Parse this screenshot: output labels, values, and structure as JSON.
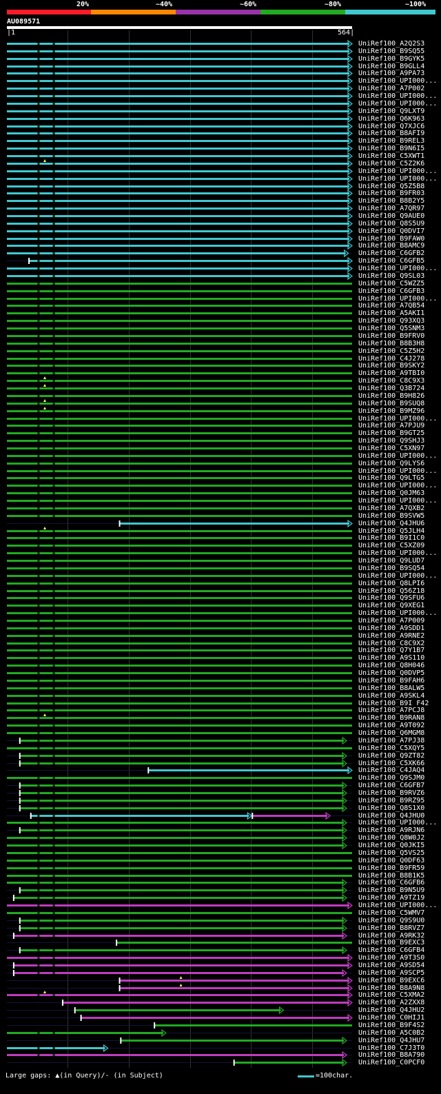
{
  "colors": {
    "cyan": "#40c8d0",
    "green": "#22aa22",
    "magenta": "#c03cc0",
    "red": "#ff1a2a",
    "orange": "#ff8800",
    "purple": "#9933aa",
    "gap_marker": "#ffff66"
  },
  "legend": {
    "labels": [
      "20%",
      "~40%",
      "~60%",
      "~80%",
      "~100%"
    ],
    "colors": [
      "#ff1a2a",
      "#ff8800",
      "#9933aa",
      "#22aa22",
      "#40c8d0"
    ]
  },
  "query": {
    "name": "AU089571",
    "start": "1",
    "end": "564"
  },
  "hits": [
    {
      "name": "UniRef100_A2Q2S3",
      "color": "cyan",
      "start": 0,
      "end": 564,
      "arrow": true
    },
    {
      "name": "UniRef100_B9SQ55",
      "color": "cyan",
      "start": 0,
      "end": 564,
      "arrow": true
    },
    {
      "name": "UniRef100_B9GYK5",
      "color": "cyan",
      "start": 0,
      "end": 564,
      "arrow": true
    },
    {
      "name": "UniRef100_B9GLL4",
      "color": "cyan",
      "start": 0,
      "end": 564,
      "arrow": true
    },
    {
      "name": "UniRef100_A9PA73",
      "color": "cyan",
      "start": 0,
      "end": 564,
      "arrow": true
    },
    {
      "name": "UniRef100_UPI000...",
      "color": "cyan",
      "start": 0,
      "end": 564,
      "arrow": true
    },
    {
      "name": "UniRef100_A7P002",
      "color": "cyan",
      "start": 0,
      "end": 564,
      "arrow": true
    },
    {
      "name": "UniRef100_UPI000...",
      "color": "cyan",
      "start": 0,
      "end": 564,
      "arrow": true
    },
    {
      "name": "UniRef100_UPI000...",
      "color": "cyan",
      "start": 0,
      "end": 564,
      "arrow": true
    },
    {
      "name": "UniRef100_Q9LXT9",
      "color": "cyan",
      "start": 0,
      "end": 564,
      "arrow": true
    },
    {
      "name": "UniRef100_Q6K963",
      "color": "cyan",
      "start": 0,
      "end": 564,
      "arrow": true
    },
    {
      "name": "UniRef100_Q7XJC6",
      "color": "cyan",
      "start": 0,
      "end": 564,
      "arrow": true
    },
    {
      "name": "UniRef100_B8AFI9",
      "color": "cyan",
      "start": 0,
      "end": 564,
      "arrow": true
    },
    {
      "name": "UniRef100_B9REL3",
      "color": "cyan",
      "start": 0,
      "end": 564,
      "arrow": true
    },
    {
      "name": "UniRef100_B9N6I5",
      "color": "cyan",
      "start": 0,
      "end": 564,
      "arrow": true
    },
    {
      "name": "UniRef100_C5XWT1",
      "color": "cyan",
      "start": 0,
      "end": 564,
      "arrow": true
    },
    {
      "name": "UniRef100_C5Z2K6",
      "color": "cyan",
      "start": 0,
      "end": 564,
      "arrow": true,
      "gap": true
    },
    {
      "name": "UniRef100_UPI000...",
      "color": "cyan",
      "start": 0,
      "end": 564,
      "arrow": true
    },
    {
      "name": "UniRef100_UPI000...",
      "color": "cyan",
      "start": 0,
      "end": 564,
      "arrow": true
    },
    {
      "name": "UniRef100_Q5Z5B8",
      "color": "cyan",
      "start": 0,
      "end": 564,
      "arrow": true
    },
    {
      "name": "UniRef100_B9FR03",
      "color": "cyan",
      "start": 0,
      "end": 564,
      "arrow": true
    },
    {
      "name": "UniRef100_B8B2Y5",
      "color": "cyan",
      "start": 0,
      "end": 564,
      "arrow": true
    },
    {
      "name": "UniRef100_A7QR97",
      "color": "cyan",
      "start": 0,
      "end": 564,
      "arrow": true
    },
    {
      "name": "UniRef100_Q9AUE0",
      "color": "cyan",
      "start": 0,
      "end": 564,
      "arrow": true
    },
    {
      "name": "UniRef100_Q8S5U9",
      "color": "cyan",
      "start": 0,
      "end": 564,
      "arrow": true
    },
    {
      "name": "UniRef100_Q0DVI7",
      "color": "cyan",
      "start": 0,
      "end": 564,
      "arrow": true
    },
    {
      "name": "UniRef100_B9FAW0",
      "color": "cyan",
      "start": 0,
      "end": 564,
      "arrow": true
    },
    {
      "name": "UniRef100_B8AMC9",
      "color": "cyan",
      "start": 0,
      "end": 564,
      "arrow": true
    },
    {
      "name": "UniRef100_C6GFB2",
      "color": "cyan",
      "start": 0,
      "end": 558,
      "arrow": true
    },
    {
      "name": "UniRef100_C6GFB5",
      "color": "cyan",
      "start": 35,
      "end": 564,
      "arrow": true
    },
    {
      "name": "UniRef100_UPI000...",
      "color": "cyan",
      "start": 0,
      "end": 564,
      "arrow": true
    },
    {
      "name": "UniRef100_Q9SL03",
      "color": "cyan",
      "start": 0,
      "end": 564,
      "arrow": true
    },
    {
      "name": "UniRef100_C5WZZ5",
      "color": "green",
      "start": 0,
      "end": 564,
      "arrow": false
    },
    {
      "name": "UniRef100_C6GFB3",
      "color": "green",
      "start": 0,
      "end": 564,
      "arrow": false
    },
    {
      "name": "UniRef100_UPI000...",
      "color": "green",
      "start": 0,
      "end": 564,
      "arrow": false
    },
    {
      "name": "UniRef100_A7QB54",
      "color": "green",
      "start": 0,
      "end": 564,
      "arrow": false
    },
    {
      "name": "UniRef100_A5AKI1",
      "color": "green",
      "start": 0,
      "end": 564,
      "arrow": false
    },
    {
      "name": "UniRef100_Q93XQ3",
      "color": "green",
      "start": 0,
      "end": 564,
      "arrow": false
    },
    {
      "name": "UniRef100_Q5SNM3",
      "color": "green",
      "start": 0,
      "end": 564,
      "arrow": false
    },
    {
      "name": "UniRef100_B9FRV0",
      "color": "green",
      "start": 0,
      "end": 564,
      "arrow": false
    },
    {
      "name": "UniRef100_B8B3H8",
      "color": "green",
      "start": 0,
      "end": 564,
      "arrow": false
    },
    {
      "name": "UniRef100_C5Z5H2",
      "color": "green",
      "start": 0,
      "end": 564,
      "arrow": false
    },
    {
      "name": "UniRef100_C4J278",
      "color": "green",
      "start": 0,
      "end": 564,
      "arrow": false
    },
    {
      "name": "UniRef100_B9SKY2",
      "color": "green",
      "start": 0,
      "end": 564,
      "arrow": false
    },
    {
      "name": "UniRef100_A9TBI0",
      "color": "green",
      "start": 0,
      "end": 564,
      "arrow": false
    },
    {
      "name": "UniRef100_C8C9X3",
      "color": "green",
      "start": 0,
      "end": 564,
      "arrow": false,
      "gap": true
    },
    {
      "name": "UniRef100_Q3B724",
      "color": "green",
      "start": 0,
      "end": 564,
      "arrow": false,
      "gap": true
    },
    {
      "name": "UniRef100_B9H826",
      "color": "green",
      "start": 0,
      "end": 564,
      "arrow": false
    },
    {
      "name": "UniRef100_B9SUQ8",
      "color": "green",
      "start": 0,
      "end": 564,
      "arrow": false,
      "gap": true
    },
    {
      "name": "UniRef100_B9MZ96",
      "color": "green",
      "start": 0,
      "end": 564,
      "arrow": false,
      "gap": true
    },
    {
      "name": "UniRef100_UPI000...",
      "color": "green",
      "start": 0,
      "end": 564,
      "arrow": false
    },
    {
      "name": "UniRef100_A7PJU9",
      "color": "green",
      "start": 0,
      "end": 564,
      "arrow": false
    },
    {
      "name": "UniRef100_B9GT25",
      "color": "green",
      "start": 0,
      "end": 564,
      "arrow": false
    },
    {
      "name": "UniRef100_Q9SHJ3",
      "color": "green",
      "start": 0,
      "end": 564,
      "arrow": false
    },
    {
      "name": "UniRef100_C5XN97",
      "color": "green",
      "start": 0,
      "end": 564,
      "arrow": false
    },
    {
      "name": "UniRef100_UPI000...",
      "color": "green",
      "start": 0,
      "end": 564,
      "arrow": false
    },
    {
      "name": "UniRef100_Q9LYS6",
      "color": "green",
      "start": 0,
      "end": 564,
      "arrow": false
    },
    {
      "name": "UniRef100_UPI000...",
      "color": "green",
      "start": 0,
      "end": 564,
      "arrow": false
    },
    {
      "name": "UniRef100_Q9LTG5",
      "color": "green",
      "start": 0,
      "end": 564,
      "arrow": false
    },
    {
      "name": "UniRef100_UPI000...",
      "color": "green",
      "start": 0,
      "end": 564,
      "arrow": false
    },
    {
      "name": "UniRef100_Q0JM63",
      "color": "green",
      "start": 0,
      "end": 564,
      "arrow": false
    },
    {
      "name": "UniRef100_UPI000...",
      "color": "green",
      "start": 0,
      "end": 564,
      "arrow": false
    },
    {
      "name": "UniRef100_A7QXB2",
      "color": "green",
      "start": 0,
      "end": 564,
      "arrow": false
    },
    {
      "name": "UniRef100_B9SVW5",
      "color": "green",
      "start": 0,
      "end": 564,
      "arrow": false
    },
    {
      "name": "UniRef100_Q4JHU6",
      "color": "cyan",
      "start": 183,
      "end": 564,
      "arrow": true
    },
    {
      "name": "UniRef100_Q5JLH4",
      "color": "green",
      "start": 0,
      "end": 564,
      "arrow": false,
      "gap": true
    },
    {
      "name": "UniRef100_B9I1C0",
      "color": "green",
      "start": 0,
      "end": 564,
      "arrow": false
    },
    {
      "name": "UniRef100_C5XZ09",
      "color": "green",
      "start": 0,
      "end": 564,
      "arrow": false
    },
    {
      "name": "UniRef100_UPI000...",
      "color": "green",
      "start": 0,
      "end": 564,
      "arrow": false
    },
    {
      "name": "UniRef100_Q9LUD7",
      "color": "green",
      "start": 0,
      "end": 564,
      "arrow": false
    },
    {
      "name": "UniRef100_B9SQ54",
      "color": "green",
      "start": 0,
      "end": 564,
      "arrow": false
    },
    {
      "name": "UniRef100_UPI000...",
      "color": "green",
      "start": 0,
      "end": 564,
      "arrow": false
    },
    {
      "name": "UniRef100_Q8LPI6",
      "color": "green",
      "start": 0,
      "end": 564,
      "arrow": false
    },
    {
      "name": "UniRef100_Q56Z18",
      "color": "green",
      "start": 0,
      "end": 564,
      "arrow": false
    },
    {
      "name": "UniRef100_Q9SFU6",
      "color": "green",
      "start": 0,
      "end": 564,
      "arrow": false
    },
    {
      "name": "UniRef100_Q9XEG1",
      "color": "green",
      "start": 0,
      "end": 564,
      "arrow": false
    },
    {
      "name": "UniRef100_UPI000...",
      "color": "green",
      "start": 0,
      "end": 564,
      "arrow": false
    },
    {
      "name": "UniRef100_A7P009",
      "color": "green",
      "start": 0,
      "end": 564,
      "arrow": false
    },
    {
      "name": "UniRef100_A9SDD1",
      "color": "green",
      "start": 0,
      "end": 564,
      "arrow": false
    },
    {
      "name": "UniRef100_A9RNE2",
      "color": "green",
      "start": 0,
      "end": 564,
      "arrow": false
    },
    {
      "name": "UniRef100_C8C9X2",
      "color": "green",
      "start": 0,
      "end": 564,
      "arrow": false
    },
    {
      "name": "UniRef100_Q7Y1B7",
      "color": "green",
      "start": 0,
      "end": 564,
      "arrow": false
    },
    {
      "name": "UniRef100_A9S110",
      "color": "green",
      "start": 0,
      "end": 564,
      "arrow": false
    },
    {
      "name": "UniRef100_Q8H046",
      "color": "green",
      "start": 0,
      "end": 564,
      "arrow": false
    },
    {
      "name": "UniRef100_Q0DVP5",
      "color": "green",
      "start": 0,
      "end": 564,
      "arrow": false
    },
    {
      "name": "UniRef100_B9FAH6",
      "color": "green",
      "start": 0,
      "end": 564,
      "arrow": false
    },
    {
      "name": "UniRef100_B8ALW5",
      "color": "green",
      "start": 0,
      "end": 564,
      "arrow": false
    },
    {
      "name": "UniRef100_A9SKL4",
      "color": "green",
      "start": 0,
      "end": 564,
      "arrow": false
    },
    {
      "name": "UniRef100_B9I F42",
      "color": "green",
      "start": 0,
      "end": 564,
      "arrow": false
    },
    {
      "name": "UniRef100_A7PCJ8",
      "color": "green",
      "start": 0,
      "end": 564,
      "arrow": false
    },
    {
      "name": "UniRef100_B9RAN8",
      "color": "green",
      "start": 0,
      "end": 564,
      "arrow": false,
      "gap": true
    },
    {
      "name": "UniRef100_A9T092",
      "color": "green",
      "start": 0,
      "end": 564,
      "arrow": false
    },
    {
      "name": "UniRef100_Q6MGM8",
      "color": "green",
      "start": 0,
      "end": 564,
      "arrow": false
    },
    {
      "name": "UniRef100_A7PJ38",
      "color": "green",
      "start": 20,
      "end": 555,
      "arrow": true
    },
    {
      "name": "UniRef100_C5XQY5",
      "color": "green",
      "start": 0,
      "end": 564,
      "arrow": false
    },
    {
      "name": "UniRef100_Q9ZT82",
      "color": "green",
      "start": 20,
      "end": 555,
      "arrow": true
    },
    {
      "name": "UniRef100_C5XK66",
      "color": "green",
      "start": 20,
      "end": 555,
      "arrow": true
    },
    {
      "name": "UniRef100_C4JAQ4",
      "color": "cyan",
      "start": 230,
      "end": 564,
      "arrow": true
    },
    {
      "name": "UniRef100_Q9SJM0",
      "color": "green",
      "start": 0,
      "end": 564,
      "arrow": false
    },
    {
      "name": "UniRef100_C6GFB7",
      "color": "green",
      "start": 20,
      "end": 555,
      "arrow": true
    },
    {
      "name": "UniRef100_B9RVZ6",
      "color": "green",
      "start": 20,
      "end": 555,
      "arrow": true
    },
    {
      "name": "UniRef100_B9RZ95",
      "color": "green",
      "start": 20,
      "end": 555,
      "arrow": true
    },
    {
      "name": "UniRef100_Q8S1X0",
      "color": "green",
      "start": 20,
      "end": 555,
      "arrow": true
    },
    {
      "name": "UniRef100_Q4JHU0",
      "color": "cyan",
      "start": 38,
      "end": 400,
      "arrow": true,
      "extra": {
        "color": "magenta",
        "start": 400,
        "end": 528
      }
    },
    {
      "name": "UniRef100_UPI000...",
      "color": "green",
      "start": 0,
      "end": 555,
      "arrow": true
    },
    {
      "name": "UniRef100_A9RJN6",
      "color": "green",
      "start": 20,
      "end": 555,
      "arrow": true
    },
    {
      "name": "UniRef100_Q8W0J2",
      "color": "green",
      "start": 0,
      "end": 555,
      "arrow": true
    },
    {
      "name": "UniRef100_Q0JKI5",
      "color": "green",
      "start": 0,
      "end": 555,
      "arrow": true
    },
    {
      "name": "UniRef100_Q5VS25",
      "color": "green",
      "start": 0,
      "end": 564,
      "arrow": false
    },
    {
      "name": "UniRef100_Q0DF63",
      "color": "green",
      "start": 0,
      "end": 564,
      "arrow": false
    },
    {
      "name": "UniRef100_B9FR59",
      "color": "green",
      "start": 0,
      "end": 564,
      "arrow": false
    },
    {
      "name": "UniRef100_B8B1K5",
      "color": "green",
      "start": 0,
      "end": 564,
      "arrow": false
    },
    {
      "name": "UniRef100_C6GFB6",
      "color": "green",
      "start": 0,
      "end": 555,
      "arrow": true
    },
    {
      "name": "UniRef100_B9N5U9",
      "color": "green",
      "start": 20,
      "end": 555,
      "arrow": true
    },
    {
      "name": "UniRef100_A9TZ19",
      "color": "green",
      "start": 10,
      "end": 555,
      "arrow": true
    },
    {
      "name": "UniRef100_UPI000...",
      "color": "magenta",
      "start": 0,
      "end": 564,
      "arrow": true
    },
    {
      "name": "UniRef100_C5WMV7",
      "color": "green",
      "start": 0,
      "end": 564,
      "arrow": false
    },
    {
      "name": "UniRef100_Q9S9U0",
      "color": "green",
      "start": 20,
      "end": 555,
      "arrow": true
    },
    {
      "name": "UniRef100_B8RVZ7",
      "color": "green",
      "start": 20,
      "end": 555,
      "arrow": true
    },
    {
      "name": "UniRef100_A9RK32",
      "color": "magenta",
      "start": 10,
      "end": 555,
      "arrow": true
    },
    {
      "name": "UniRef100_B9EXC3",
      "color": "green",
      "start": 178,
      "end": 564,
      "arrow": false
    },
    {
      "name": "UniRef100_C6GFB4",
      "color": "green",
      "start": 20,
      "end": 555,
      "arrow": true
    },
    {
      "name": "UniRef100_A9T3S0",
      "color": "magenta",
      "start": 0,
      "end": 564,
      "arrow": true
    },
    {
      "name": "UniRef100_A9SD54",
      "color": "magenta",
      "start": 10,
      "end": 564,
      "arrow": true
    },
    {
      "name": "UniRef100_A9SCP5",
      "color": "magenta",
      "start": 10,
      "end": 555,
      "arrow": true
    },
    {
      "name": "UniRef100_B9EXC6",
      "color": "magenta",
      "start": 183,
      "end": 564,
      "arrow": true,
      "gap": true
    },
    {
      "name": "UniRef100_B8A9N8",
      "color": "magenta",
      "start": 183,
      "end": 564,
      "arrow": true,
      "gap": true
    },
    {
      "name": "UniRef100_C5XMA2",
      "color": "magenta",
      "start": 0,
      "end": 564,
      "arrow": true,
      "gap": true
    },
    {
      "name": "UniRef100_A2ZXX8",
      "color": "magenta",
      "start": 90,
      "end": 564,
      "arrow": true
    },
    {
      "name": "UniRef100_Q4JHU2",
      "color": "green",
      "start": 110,
      "end": 452,
      "arrow": true
    },
    {
      "name": "UniRef100_C0HIJ1",
      "color": "magenta",
      "start": 120,
      "end": 564,
      "arrow": true
    },
    {
      "name": "UniRef100_B9F4S2",
      "color": "green",
      "start": 240,
      "end": 564,
      "arrow": false
    },
    {
      "name": "UniRef100_A5C0B2",
      "color": "green",
      "start": 0,
      "end": 260,
      "arrow": true
    },
    {
      "name": "UniRef100_Q4JHU7",
      "color": "green",
      "start": 185,
      "end": 555,
      "arrow": true
    },
    {
      "name": "UniRef100_C7J3T0",
      "color": "cyan",
      "start": 0,
      "end": 165,
      "arrow": true
    },
    {
      "name": "UniRef100_B8A790",
      "color": "magenta",
      "start": 0,
      "end": 555,
      "arrow": true
    },
    {
      "name": "UniRef100_C0PCF0",
      "color": "green",
      "start": 370,
      "end": 555,
      "arrow": true
    }
  ],
  "footer": {
    "gaps_text": "Large gaps: ▲(in Query)/- (in Subject)",
    "scale_text": "=100char."
  }
}
